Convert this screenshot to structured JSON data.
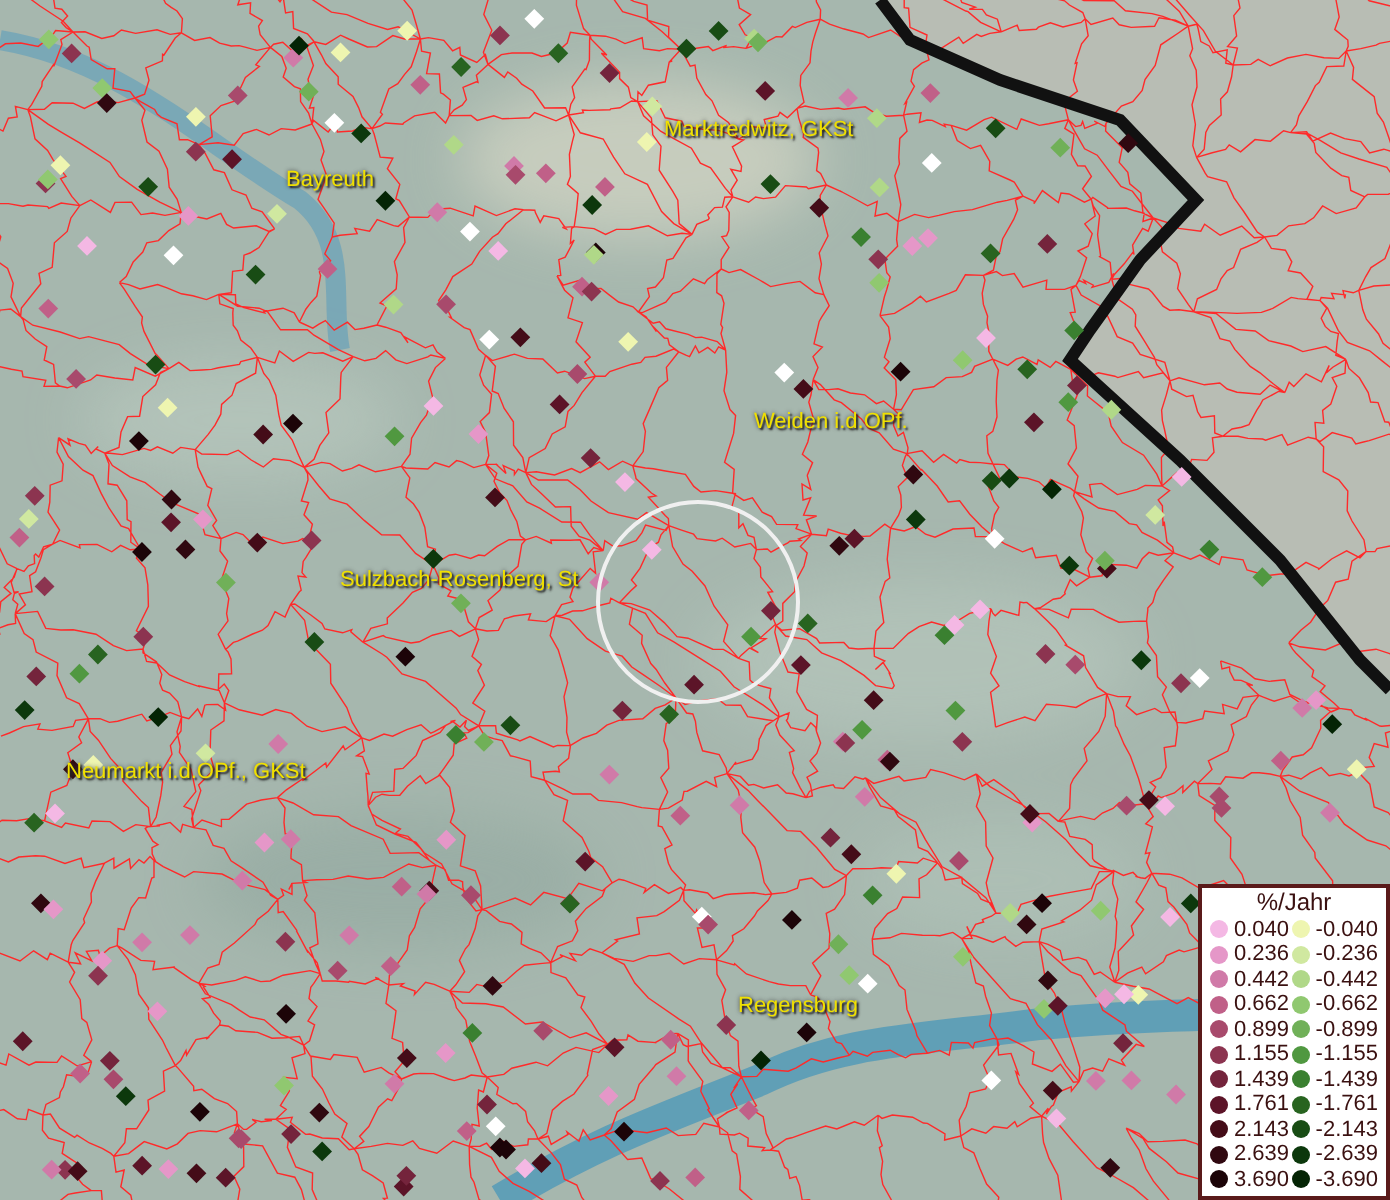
{
  "map": {
    "places": [
      {
        "name": "Bayreuth"
      },
      {
        "name": "Marktredwitz, GKSt"
      },
      {
        "name": "Weiden i.d.OPf."
      },
      {
        "name": "Sulzbach-Rosenberg, St"
      },
      {
        "name": "Neumarkt i.d.OPf., GKSt"
      },
      {
        "name": "Regensburg"
      }
    ],
    "legend": {
      "title": "%/Jahr",
      "rows": [
        {
          "left": {
            "value": "0.040",
            "color": "#f4b8e4"
          },
          "right": {
            "value": "-0.040",
            "color": "#eef5b0"
          }
        },
        {
          "left": {
            "value": "0.236",
            "color": "#e597c8"
          },
          "right": {
            "value": "-0.236",
            "color": "#d0e8a0"
          }
        },
        {
          "left": {
            "value": "0.442",
            "color": "#d07aa8"
          },
          "right": {
            "value": "-0.442",
            "color": "#b0d888"
          }
        },
        {
          "left": {
            "value": "0.662",
            "color": "#c06088"
          },
          "right": {
            "value": "-0.662",
            "color": "#90c870"
          }
        },
        {
          "left": {
            "value": "0.899",
            "color": "#a84a6c"
          },
          "right": {
            "value": "-0.899",
            "color": "#70b058"
          }
        },
        {
          "left": {
            "value": "1.155",
            "color": "#8c3450"
          },
          "right": {
            "value": "-1.155",
            "color": "#509840"
          }
        },
        {
          "left": {
            "value": "1.439",
            "color": "#74243c"
          },
          "right": {
            "value": "-1.439",
            "color": "#3a8030"
          }
        },
        {
          "left": {
            "value": "1.761",
            "color": "#5c1428"
          },
          "right": {
            "value": "-1.761",
            "color": "#286420"
          }
        },
        {
          "left": {
            "value": "2.143",
            "color": "#440c18"
          },
          "right": {
            "value": "-2.143",
            "color": "#184c14"
          }
        },
        {
          "left": {
            "value": "2.639",
            "color": "#300810"
          },
          "right": {
            "value": "-2.639",
            "color": "#0c380c"
          }
        },
        {
          "left": {
            "value": "3.690",
            "color": "#1c0408"
          },
          "right": {
            "value": "-3.690",
            "color": "#042404"
          }
        }
      ]
    }
  }
}
